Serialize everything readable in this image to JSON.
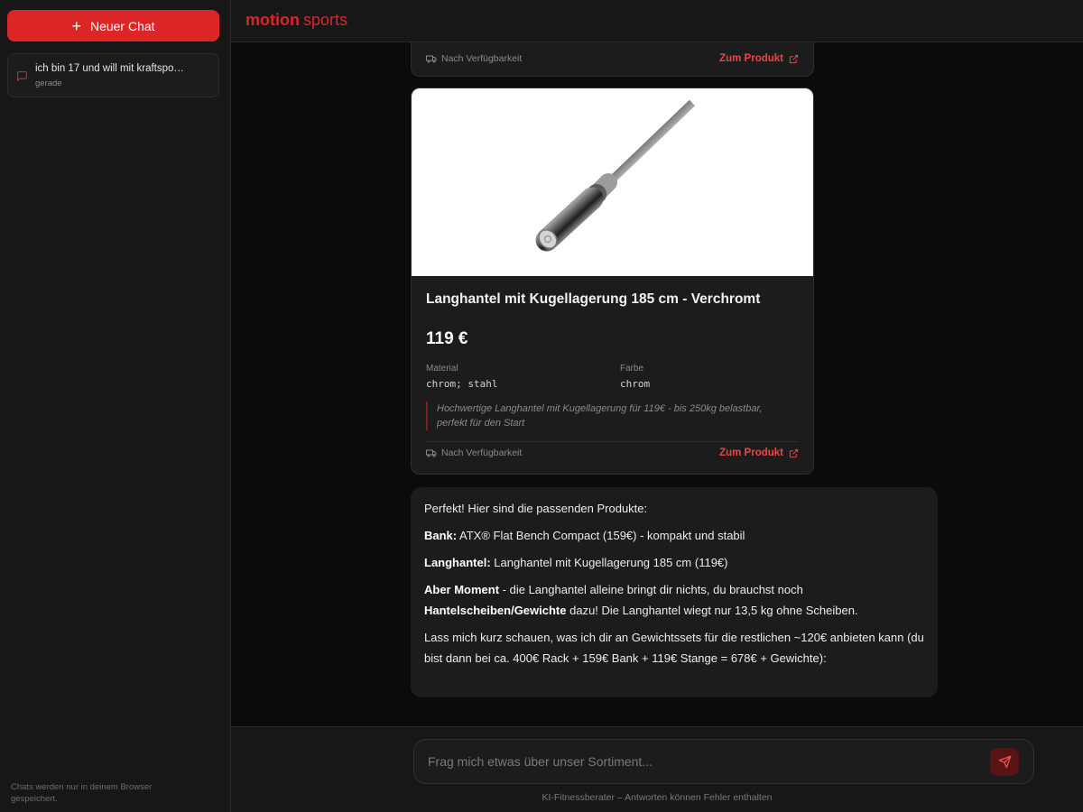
{
  "sidebar": {
    "new_chat_label": "Neuer Chat",
    "chats": [
      {
        "title": "ich bin 17 und will mit kraftspo…",
        "time": "gerade"
      }
    ],
    "note": "Chats werden nur in deinem Browser gespeichert."
  },
  "header": {
    "brand_bold": "motion",
    "brand_regular": "sports"
  },
  "messages": {
    "previous_card": {
      "availability": "Nach Verfügbarkeit",
      "link_label": "Zum Produkt"
    },
    "product_card": {
      "image_alt": "Langhantel verchromt",
      "title": "Langhantel mit Kugellagerung 185 cm - Verchromt",
      "price": "119 €",
      "specs": [
        {
          "label": "Material",
          "value": "chrom; stahl"
        },
        {
          "label": "Farbe",
          "value": "chrom"
        }
      ],
      "note": "Hochwertige Langhantel mit Kugellagerung für 119€ - bis 250kg belastbar, perfekt für den Start",
      "availability": "Nach Verfügbarkeit",
      "link_label": "Zum Produkt"
    },
    "assistant_reply": {
      "intro": "Perfekt! Hier sind die passenden Produkte:",
      "bank_label": "Bank:",
      "bank_text": " ATX® Flat Bench Compact (159€) - kompakt und stabil",
      "bar_label": "Langhantel:",
      "bar_text": " Langhantel mit Kugellagerung 185 cm (119€)",
      "wait_label": "Aber Moment",
      "wait_text": " - die Langhantel alleine bringt dir nichts, du brauchst noch ",
      "plates_label": "Hantelscheiben/Gewichte",
      "plates_text": " dazu! Die Langhantel wiegt nur 13,5 kg ohne Scheiben.",
      "closing": "Lass mich kurz schauen, was ich dir an Gewichtssets für die restlichen ~120€ anbieten kann (du bist dann bei ca. 400€ Rack + 159€ Bank + 119€ Stange = 678€ + Gewichte):"
    }
  },
  "composer": {
    "placeholder": "Frag mich etwas über unser Sortiment...",
    "value": "",
    "disclaimer": "KI-Fitnessberater – Antworten können Fehler enthalten"
  },
  "colors": {
    "accent": "#dc2626",
    "background": "#0b0b0b",
    "panel": "#171717",
    "card": "#1c1c1c"
  },
  "icons": {
    "new_chat": "plus-icon",
    "chat_item": "message-square-icon",
    "availability": "truck-icon",
    "product_link": "external-link-icon",
    "send": "send-icon"
  }
}
